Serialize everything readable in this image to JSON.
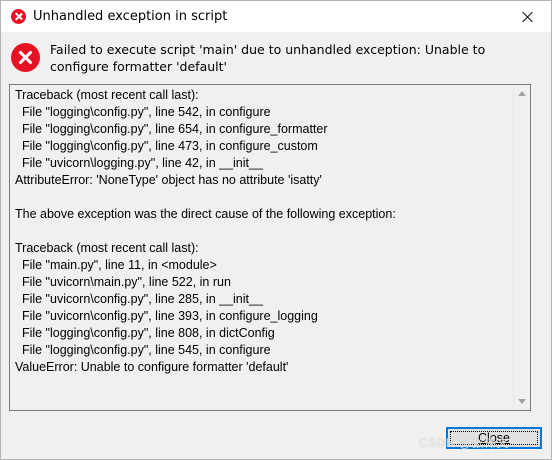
{
  "window": {
    "title": "Unhandled exception in script",
    "close_icon": "close-icon",
    "title_icon": "error-icon"
  },
  "message": {
    "icon": "error-icon",
    "text": "Failed to execute script 'main' due to unhandled exception: Unable to configure formatter 'default'"
  },
  "traceback": {
    "text": "Traceback (most recent call last):\n  File \"logging\\config.py\", line 542, in configure\n  File \"logging\\config.py\", line 654, in configure_formatter\n  File \"logging\\config.py\", line 473, in configure_custom\n  File \"uvicorn\\logging.py\", line 42, in __init__\nAttributeError: 'NoneType' object has no attribute 'isatty'\n\nThe above exception was the direct cause of the following exception:\n\nTraceback (most recent call last):\n  File \"main.py\", line 11, in <module>\n  File \"uvicorn\\main.py\", line 522, in run\n  File \"uvicorn\\config.py\", line 285, in __init__\n  File \"uvicorn\\config.py\", line 393, in configure_logging\n  File \"logging\\config.py\", line 808, in dictConfig\n  File \"logging\\config.py\", line 545, in configure\nValueError: Unable to configure formatter 'default'"
  },
  "buttons": {
    "close_label": "Close"
  },
  "watermark": "CSDN @张伟文",
  "colors": {
    "error_red": "#e81123",
    "focus_blue": "#0078d7",
    "dialog_bg": "#f0f0f0"
  }
}
